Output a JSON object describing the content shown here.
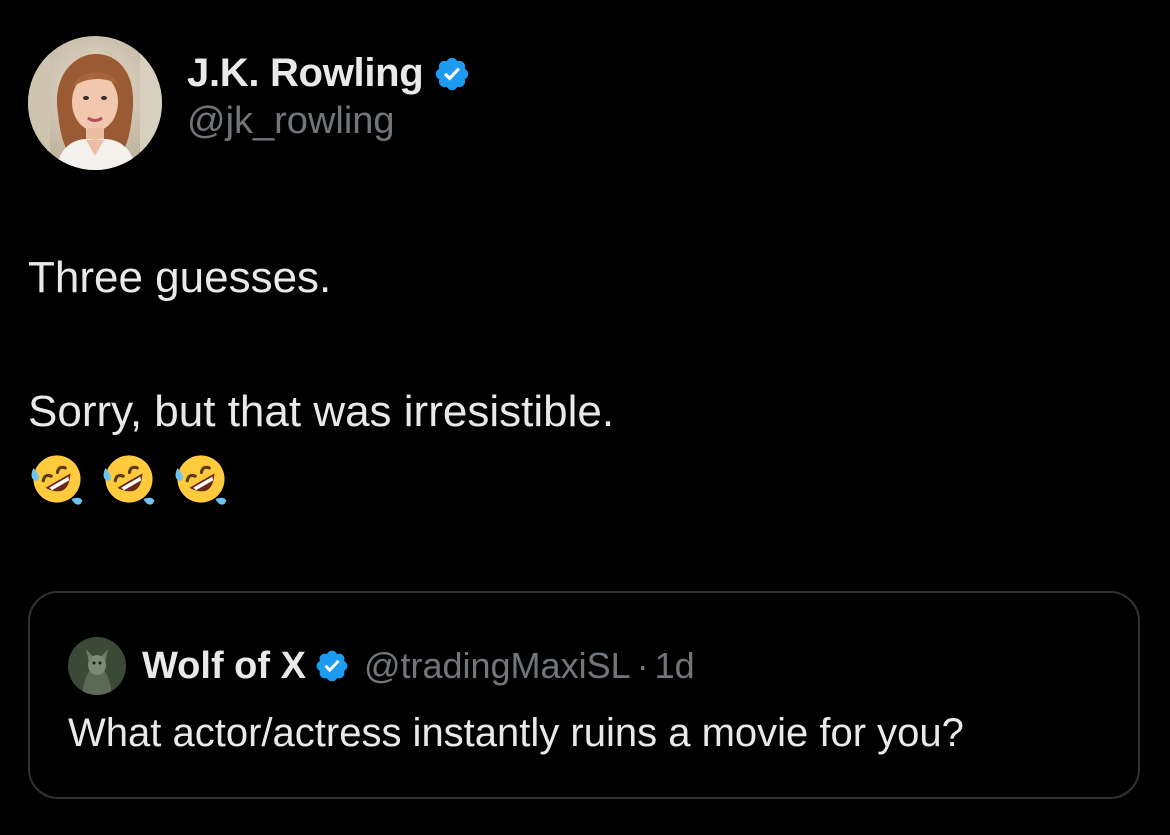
{
  "colors": {
    "background": "#000000",
    "text_primary": "#e7e9ea",
    "text_secondary": "#71767b",
    "verified_badge": "#1d9bf0",
    "card_border": "#2f3336"
  },
  "tweet": {
    "author_name": "J.K. Rowling",
    "author_handle": "@jk_rowling",
    "avatar_icon": "profile-photo",
    "verified_icon": "verified-badge-icon",
    "text_line_1": "Three guesses.",
    "text_line_2": "Sorry, but that was irresistible.",
    "emojis": [
      "rolling-on-floor-laughing",
      "rolling-on-floor-laughing",
      "rolling-on-floor-laughing"
    ]
  },
  "quoted_tweet": {
    "author_name": "Wolf of X",
    "author_handle": "@tradingMaxiSL",
    "separator": "·",
    "time": "1d",
    "text": "What actor/actress instantly ruins a movie for you?"
  }
}
